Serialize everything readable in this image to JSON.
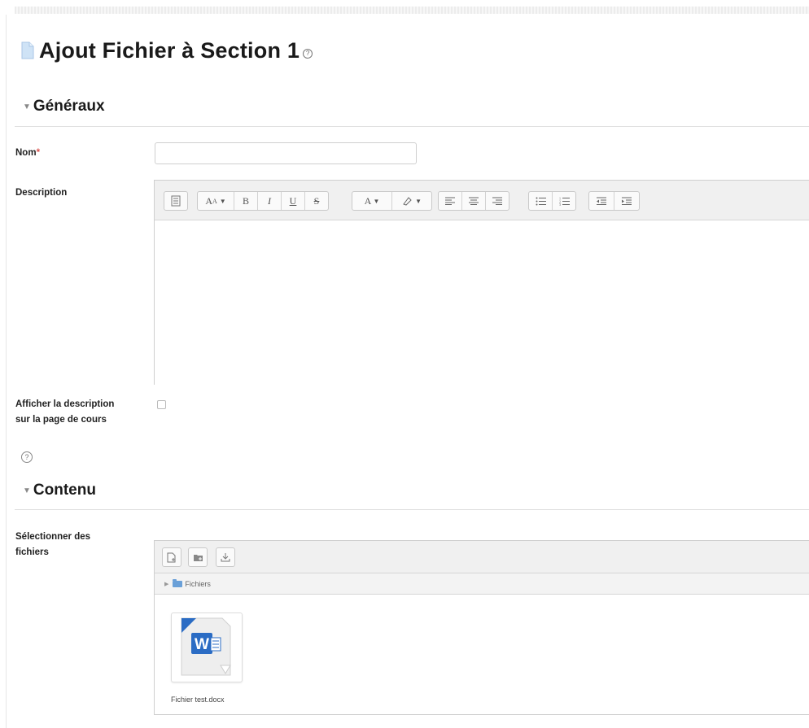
{
  "page": {
    "title": "Ajout Fichier à Section 1",
    "title_help_icon": "help-icon"
  },
  "sections": {
    "general": {
      "label": "Généraux",
      "toggle_icon": "triangle-down-icon"
    },
    "content": {
      "label": "Contenu",
      "toggle_icon": "triangle-down-icon"
    }
  },
  "form": {
    "name": {
      "label": "Nom",
      "required_mark": "*",
      "value": ""
    },
    "description": {
      "label": "Description"
    },
    "show_description": {
      "label": "Afficher la description sur la page de cours",
      "checked": false,
      "help_icon": "help-icon"
    },
    "select_files": {
      "label": "Sélectionner des fichiers"
    }
  },
  "editor": {
    "toolbar_groups": [
      [
        "toggle-toolbar-icon"
      ],
      [
        "heading-dropdown-icon",
        "bold-icon",
        "italic-icon",
        "underline-icon",
        "strikethrough-icon"
      ],
      [
        "font-color-dropdown-icon",
        "highlight-dropdown-icon"
      ],
      [
        "align-left-icon",
        "align-center-icon",
        "align-right-icon"
      ],
      [
        "bullet-list-icon",
        "numbered-list-icon"
      ],
      [
        "outdent-icon",
        "indent-icon"
      ]
    ],
    "content": ""
  },
  "filepicker": {
    "toolbar": [
      "add-file-icon",
      "create-folder-icon",
      "download-icon"
    ],
    "path_label": "Fichiers",
    "files": [
      {
        "name": "Fichier test.docx",
        "icon": "word-document-icon"
      }
    ]
  },
  "colors": {
    "accent_blue": "#2b6cc4",
    "required_red": "#d9534f",
    "toolbar_bg": "#f0f0f0"
  }
}
